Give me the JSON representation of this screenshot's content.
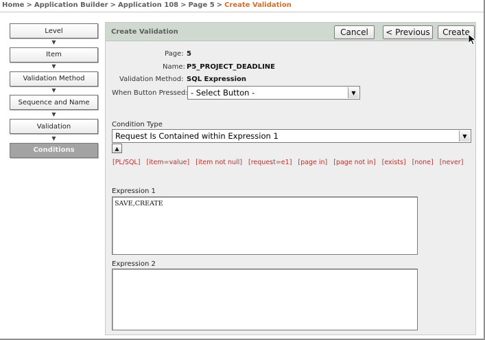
{
  "breadcrumb": {
    "items": [
      "Home",
      "Application Builder",
      "Application 108",
      "Page 5"
    ],
    "separator": ">",
    "current": "Create Validation"
  },
  "steps": [
    {
      "label": "Level",
      "active": false
    },
    {
      "label": "Item",
      "active": false
    },
    {
      "label": "Validation Method",
      "active": false
    },
    {
      "label": "Sequence and Name",
      "active": false
    },
    {
      "label": "Validation",
      "active": false
    },
    {
      "label": "Conditions",
      "active": true
    }
  ],
  "panel": {
    "title": "Create Validation",
    "buttons": {
      "cancel": "Cancel",
      "previous": "< Previous",
      "create": "Create"
    }
  },
  "summary": {
    "page_label": "Page:",
    "page_value": "5",
    "name_label": "Name:",
    "name_value": "P5_PROJECT_DEADLINE",
    "method_label": "Validation Method:",
    "method_value": "SQL Expression"
  },
  "when_button_pressed": {
    "label": "When Button Pressed:",
    "value": "- Select Button -"
  },
  "condition_type": {
    "label": "Condition Type",
    "value": "Request Is Contained within Expression 1"
  },
  "shortcuts": [
    "[PL/SQL]",
    "[item=value]",
    "[item not null]",
    "[request=e1]",
    "[page in]",
    "[page not in]",
    "[exists]",
    "[none]",
    "[never]"
  ],
  "expression1": {
    "label": "Expression 1",
    "value": "SAVE,CREATE"
  },
  "expression2": {
    "label": "Expression 2",
    "value": ""
  },
  "colors": {
    "accent_orange": "#e06a1a",
    "link_red": "#b8322b",
    "header_green": "#cfd9cf"
  }
}
